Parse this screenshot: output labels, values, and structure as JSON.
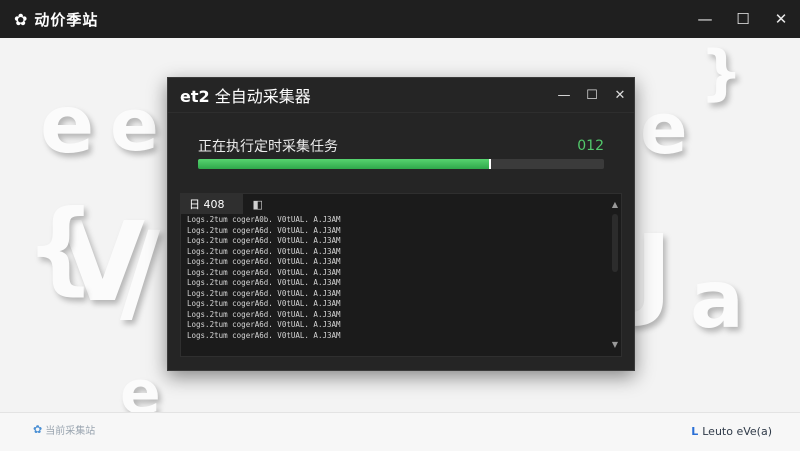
{
  "app": {
    "title": "动价季站",
    "logo_icon": "flower-icon",
    "controls": {
      "minimize": "—",
      "maximize": "☐",
      "close": "✕"
    }
  },
  "dialog": {
    "title_bold": "et2",
    "title_rest": " 全自动采集器",
    "controls": {
      "minimize": "—",
      "maximize": "☐",
      "close": "✕"
    },
    "task_label": "正在执行定时采集任务",
    "task_count": "012",
    "progress": 0.72,
    "accent_color": "#47c461"
  },
  "log": {
    "tab_label": "日 408",
    "tab2_icon": "◧",
    "lines": [
      "Logs.2tum cogerA0b. V0tUAL. A.J3AM",
      "Logs.2tum cogerA6d. V0tUAL. A.J3AM",
      "Logs.2tum cogerA6d. V0tUAL. A.J3AM",
      "Logs.2tum cogerA6d. V0tUAL. A.J3AM",
      "Logs.2tum cogerA6d. V0tUAL. A.J3AM",
      "Logs.2tum cogerA6d. V0tUAL. A.J3AM",
      "Logs.2tum cogerA6d. V0tUAL. A.J3AM",
      "Logs.2tum cogerA6d. V0tUAL. A.J3AM",
      "Logs.2tum cogerA6d. V0tUAL. A.J3AM",
      "Logs.2tum cogerA6d. V0tUAL. A.J3AM",
      "Logs.2tum cogerA6d. V0tUAL. A.J3AM",
      "Logs.2tum cogerA6d. V0tUAL. A.J3AM"
    ]
  },
  "footer": {
    "left_text": "当前采集站",
    "right_text": "Leuto eVe(a)",
    "right_mark": "L"
  },
  "background": {
    "art": [
      "e",
      "e",
      "e",
      "V",
      "/",
      "{",
      "}",
      "J",
      "a",
      "e"
    ]
  }
}
